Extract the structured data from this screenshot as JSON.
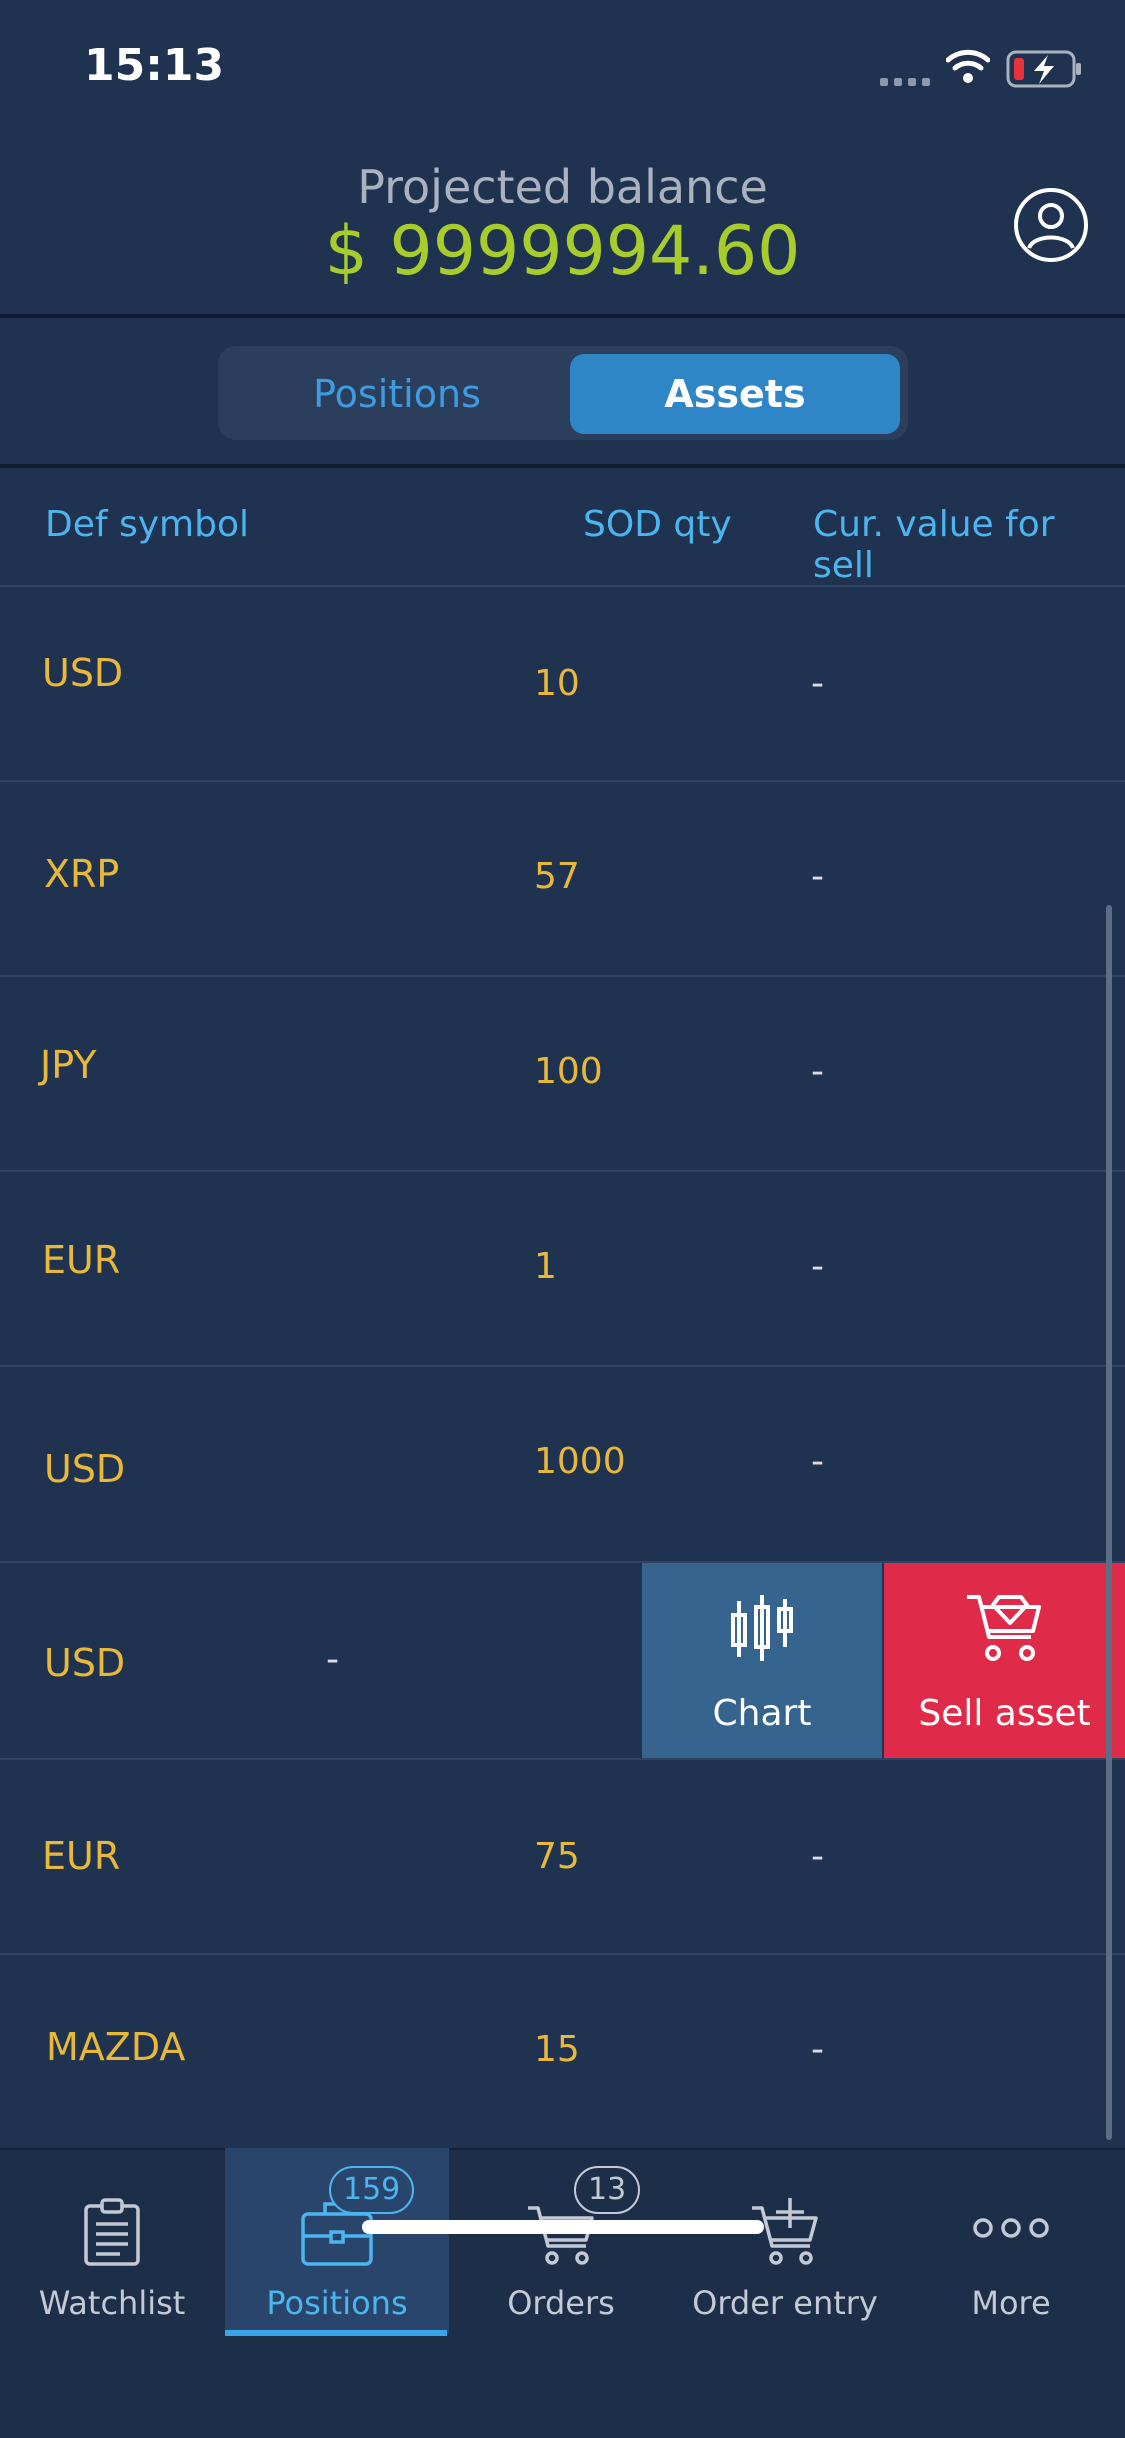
{
  "status_bar": {
    "time": "15:13"
  },
  "header": {
    "label": "Projected balance",
    "value": "$ 9999994.60"
  },
  "segmented": {
    "positions": "Positions",
    "assets": "Assets"
  },
  "columns": {
    "symbol": "Def symbol",
    "qty": "SOD qty",
    "value": "Cur. value for sell"
  },
  "rows": [
    {
      "symbol": "USD",
      "qty": "10",
      "value": "-"
    },
    {
      "symbol": "XRP",
      "qty": "57",
      "value": "-"
    },
    {
      "symbol": "JPY",
      "qty": "100",
      "value": "-"
    },
    {
      "symbol": "EUR",
      "qty": "1",
      "value": "-"
    },
    {
      "symbol": "USD",
      "qty": "1000",
      "value": "-"
    },
    {
      "symbol": "USD",
      "qty": "",
      "value": "-"
    },
    {
      "symbol": "EUR",
      "qty": "75",
      "value": "-"
    },
    {
      "symbol": "MAZDA",
      "qty": "15",
      "value": "-"
    }
  ],
  "swipe_actions": {
    "chart": "Chart",
    "sell": "Sell asset"
  },
  "tabs": [
    {
      "label": "Watchlist",
      "icon": "clipboard-icon",
      "badge": ""
    },
    {
      "label": "Positions",
      "icon": "briefcase-icon",
      "badge": "159"
    },
    {
      "label": "Orders",
      "icon": "cart-icon",
      "badge": "13"
    },
    {
      "label": "Order entry",
      "icon": "cart-plus-icon",
      "badge": ""
    },
    {
      "label": "More",
      "icon": "more-dots-icon",
      "badge": ""
    }
  ],
  "colors": {
    "accent": "#2f86c7",
    "balance": "#a8cc2c",
    "symbol": "#e8b83a",
    "sell": "#e02a4a",
    "background": "#1f324f"
  }
}
